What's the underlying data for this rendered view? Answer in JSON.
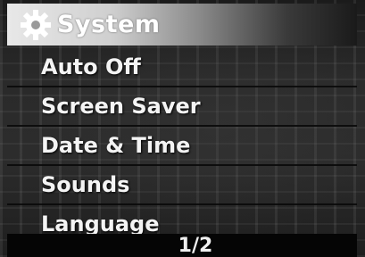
{
  "header": {
    "title": "System",
    "icon": "gear-icon"
  },
  "menu": {
    "items": [
      {
        "label": "Auto Off"
      },
      {
        "label": "Screen Saver"
      },
      {
        "label": "Date & Time"
      },
      {
        "label": "Sounds"
      },
      {
        "label": "Language"
      }
    ]
  },
  "pager": {
    "text": "1/2"
  }
}
